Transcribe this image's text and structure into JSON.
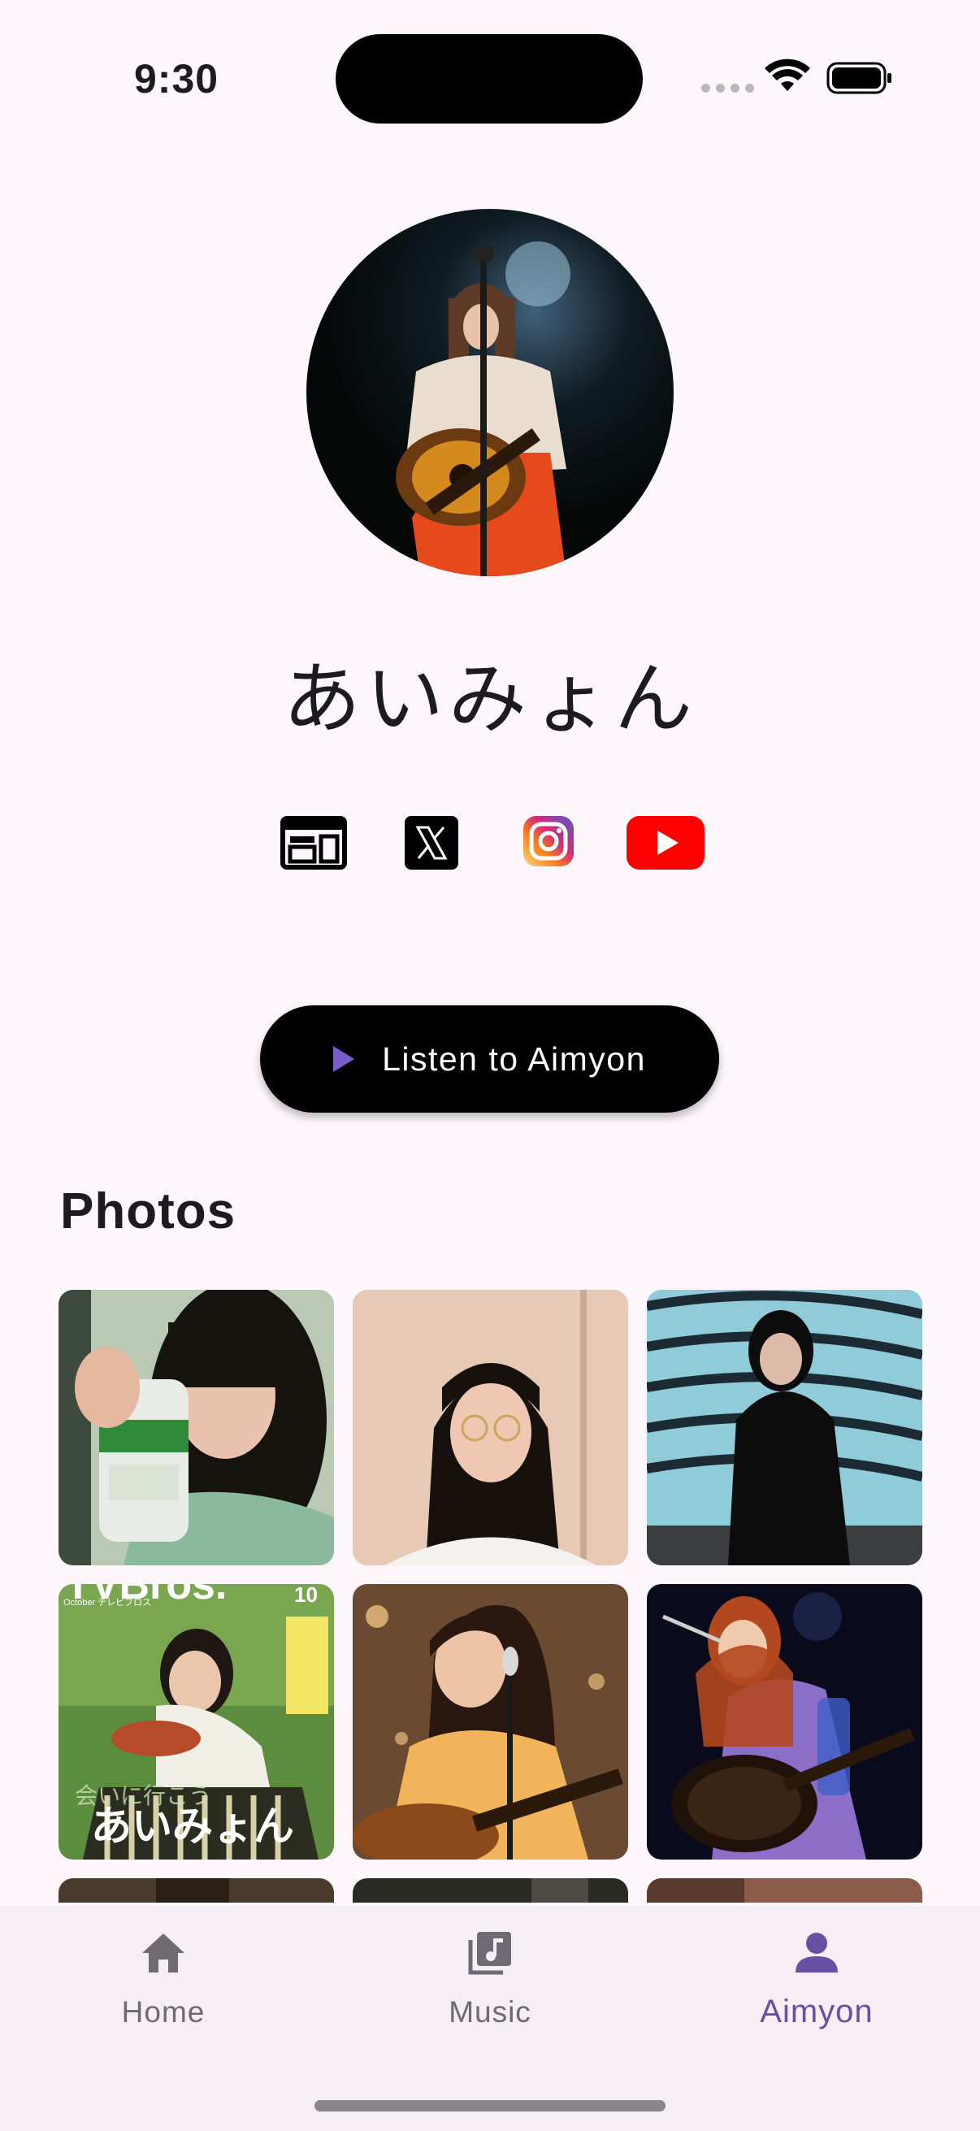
{
  "status_bar": {
    "time": "9:30"
  },
  "profile": {
    "name": "あいみょん"
  },
  "social_links": [
    {
      "name": "website",
      "icon": "web-icon"
    },
    {
      "name": "x",
      "icon": "x-icon"
    },
    {
      "name": "instagram",
      "icon": "instagram-icon"
    },
    {
      "name": "youtube",
      "icon": "youtube-icon"
    }
  ],
  "listen_button": {
    "label": "Listen to Aimyon",
    "icon": "play-icon"
  },
  "photos_section": {
    "title": "Photos",
    "cover_text": {
      "logo": "TVBros.",
      "issue": "10",
      "month": "October テレビブロス",
      "title": "あいみょん",
      "subtitle": "会いに行こう"
    }
  },
  "bottom_nav": {
    "items": [
      {
        "label": "Home",
        "icon": "home-icon",
        "active": false
      },
      {
        "label": "Music",
        "icon": "music-library-icon",
        "active": false
      },
      {
        "label": "Aimyon",
        "icon": "person-icon",
        "active": true
      }
    ]
  },
  "colors": {
    "accent": "#6750a4",
    "background": "#fdf6fb",
    "play_icon": "#7b5cc9",
    "youtube_red": "#ff0000"
  }
}
